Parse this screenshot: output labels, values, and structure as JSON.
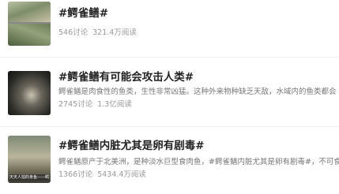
{
  "topics": [
    {
      "title": "#鳄雀鳝#",
      "description": "",
      "discussions": "546讨论",
      "reads": "321.4万阅读",
      "thumbnail_icon": "fish-photo-collage"
    },
    {
      "title": "#鳄雀鳝有可能会攻击人类#",
      "description": "鳄雀鳝是肉食性的鱼类，生性非常凶猛。这种外来物种缺乏天敌，水域内的鱼类都会",
      "discussions": "2745讨论",
      "reads": "1.3亿阅读",
      "thumbnail_icon": "fish-photo"
    },
    {
      "title": "#鳄雀鳝内脏尤其是卵有剧毒#",
      "description": "鳄雀鳝原产于北美洲，是种淡水巨型食肉鱼，#鳄雀鳝内脏尤其是卵有剧毒#，不可食",
      "discussions": "1366讨论",
      "reads": "5434.4万阅读",
      "thumbnail_icon": "video-thumbnail",
      "thumbnail_caption": "天天人拍的身鱼——鳄雀鳝"
    }
  ]
}
